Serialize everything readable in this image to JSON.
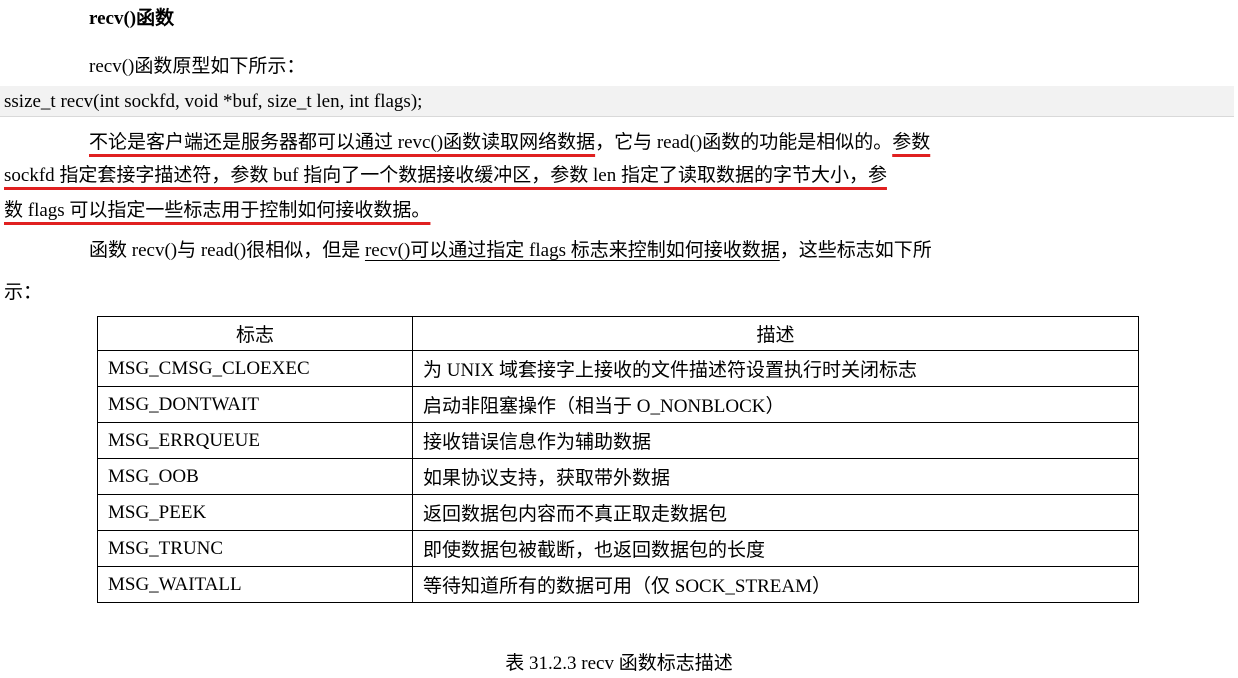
{
  "heading": "recv()函数",
  "intro": "recv()函数原型如下所示：",
  "code": "ssize_t recv(int sockfd, void *buf, size_t len, int flags);",
  "para1": {
    "l1_ul": "不论是客户端还是服务器都可以通过 revc()函数读取网络数据",
    "l1_rest": "，它与 read()函数的功能是相似的。",
    "l1_ul2": "参数",
    "l2": "sockfd 指定套接字描述符，参数 buf 指向了一个数据接收缓冲区，参数 len 指定了读取数据的字节大小，参",
    "l3": "数 flags 可以指定一些标志用于控制如何接收数据。"
  },
  "para2": {
    "l1_a": "函数 recv()与 read()很相似，但是 ",
    "l1_ul": "recv()可以通过指定 flags 标志来控制如何接收数据",
    "l1_b": "，这些标志如下所",
    "l2": "示："
  },
  "table": {
    "headers": [
      "标志",
      "描述"
    ],
    "rows": [
      [
        "MSG_CMSG_CLOEXEC",
        "为 UNIX 域套接字上接收的文件描述符设置执行时关闭标志"
      ],
      [
        "MSG_DONTWAIT",
        "启动非阻塞操作（相当于 O_NONBLOCK）"
      ],
      [
        "MSG_ERRQUEUE",
        "接收错误信息作为辅助数据"
      ],
      [
        "MSG_OOB",
        "如果协议支持，获取带外数据"
      ],
      [
        "MSG_PEEK",
        "返回数据包内容而不真正取走数据包"
      ],
      [
        "MSG_TRUNC",
        "即使数据包被截断，也返回数据包的长度"
      ],
      [
        "MSG_WAITALL",
        "等待知道所有的数据可用（仅 SOCK_STREAM）"
      ]
    ]
  },
  "caption": "表 31.2.3 recv 函数标志描述",
  "colors": {
    "underline": "#e02020",
    "code_bg": "#f2f2f2"
  }
}
